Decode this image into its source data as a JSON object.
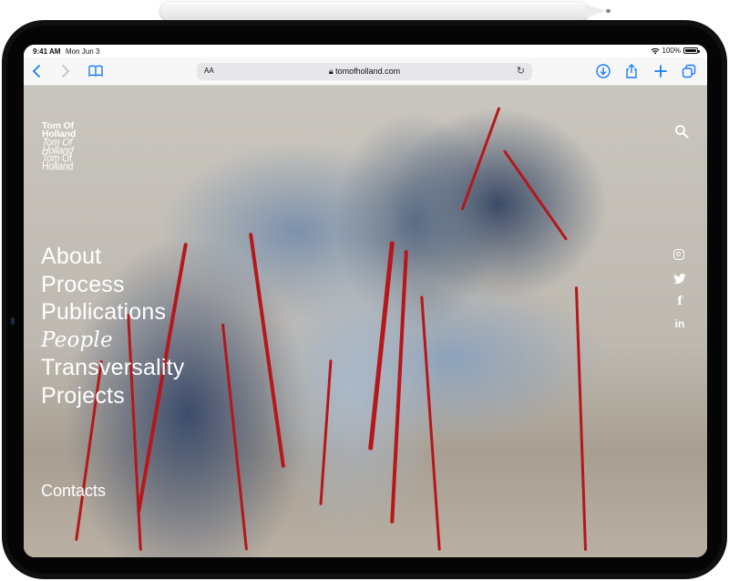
{
  "status": {
    "time": "9:41 AM",
    "date": "Mon Jun 3",
    "battery": "100%"
  },
  "browser": {
    "text_size_label": "AA",
    "url": "tomofholland.com"
  },
  "site": {
    "logo_lines": [
      "Tom Of",
      "Holland",
      "Tom Of",
      "Holland",
      "Tom Of",
      "Holland"
    ],
    "menu": [
      "About",
      "Process",
      "Publications",
      "People",
      "Transversality",
      "Projects"
    ],
    "contacts_label": "Contacts"
  },
  "colors": {
    "accent": "#1a7cf5",
    "stitch_red": "#b5171b"
  },
  "icons": [
    "back-icon",
    "forward-icon",
    "bookmarks-icon",
    "reload-icon",
    "download-icon",
    "share-icon",
    "new-tab-icon",
    "tabs-icon",
    "search-icon",
    "instagram-icon",
    "twitter-icon",
    "facebook-icon",
    "linkedin-icon"
  ]
}
